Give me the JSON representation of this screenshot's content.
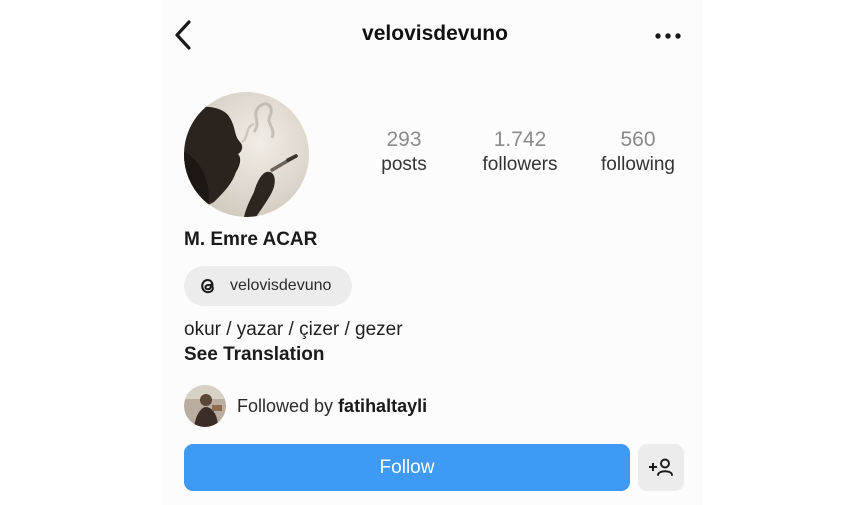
{
  "header": {
    "title": "velovisdevuno",
    "back_icon": "chevron-left-icon",
    "more_icon": "more-horizontal-icon"
  },
  "profile": {
    "avatar_icon": "profile-photo",
    "stats": [
      {
        "value": "293",
        "label": "posts"
      },
      {
        "value": "1.742",
        "label": "followers"
      },
      {
        "value": "560",
        "label": "following"
      }
    ],
    "full_name": "M. Emre ACAR",
    "threads": {
      "icon": "threads-icon",
      "handle": "velovisdevuno"
    },
    "bio": "okur / yazar / çizer / gezer",
    "translate_label": "See Translation",
    "followed_by": {
      "prefix": "Followed by ",
      "user": "fatihaltayli"
    }
  },
  "actions": {
    "follow_label": "Follow",
    "add_user_icon": "add-user-icon"
  },
  "colors": {
    "follow_button": "#3f9af3",
    "pill_background": "#ececec",
    "stat_number": "#8a8a8a"
  }
}
